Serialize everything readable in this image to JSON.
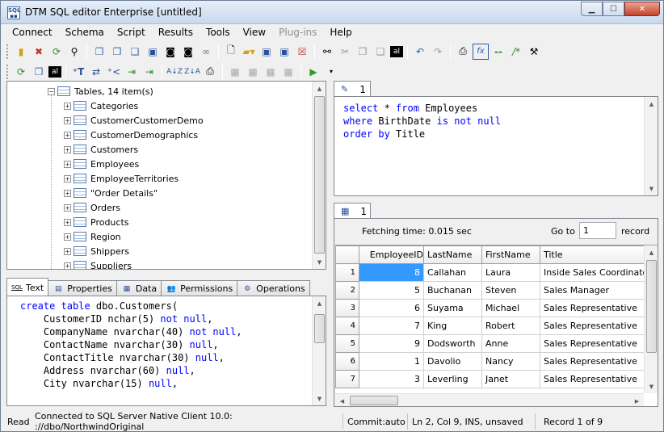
{
  "window": {
    "title": "DTM SQL editor Enterprise [untitled]",
    "controls": {
      "minimize": "minimize",
      "maximize": "maximize",
      "close": "close"
    }
  },
  "menu": {
    "items": [
      {
        "label": "Connect",
        "enabled": true
      },
      {
        "label": "Schema",
        "enabled": true
      },
      {
        "label": "Script",
        "enabled": true
      },
      {
        "label": "Results",
        "enabled": true
      },
      {
        "label": "Tools",
        "enabled": true
      },
      {
        "label": "View",
        "enabled": true
      },
      {
        "label": "Plug-ins",
        "enabled": false
      },
      {
        "label": "Help",
        "enabled": true
      }
    ]
  },
  "toolbar1": {
    "icons": [
      "connect-icon",
      "disconnect-icon",
      "refresh-icon",
      "find-icon",
      "copy-icon",
      "copy-special-icon",
      "paste-icon",
      "save-icon",
      "camera-icon",
      "camera-all-icon",
      "chain-icon",
      "new-file-icon",
      "open-folder-icon",
      "save-file-icon",
      "save-all-icon",
      "close-file-icon",
      "binoculars-icon",
      "cut-icon",
      "copy-text-icon",
      "paste-text-icon",
      "al-icon",
      "undo-icon",
      "redo-icon",
      "print-icon",
      "function-icon",
      "comment-icon",
      "uncomment-icon",
      "settings-icon"
    ]
  },
  "toolbar2": {
    "icons": [
      "refresh-icon",
      "copy-icon",
      "al-icon",
      "insert-text-icon",
      "compare-icon",
      "export-icon",
      "import-icon",
      "sort-az-icon",
      "sort-za-icon",
      "print-icon",
      "table-copy-icon",
      "table-paste-icon",
      "table-add-icon",
      "table-delete-icon",
      "run-icon",
      "run-dropdown-icon"
    ]
  },
  "tree": {
    "root": {
      "label": "Tables, 14 item(s)",
      "expanded": true
    },
    "items": [
      {
        "label": "Categories"
      },
      {
        "label": "CustomerCustomerDemo"
      },
      {
        "label": "CustomerDemographics"
      },
      {
        "label": "Customers"
      },
      {
        "label": "Employees"
      },
      {
        "label": "EmployeeTerritories"
      },
      {
        "label": "\"Order Details\""
      },
      {
        "label": "Orders"
      },
      {
        "label": "Products"
      },
      {
        "label": "Region"
      },
      {
        "label": "Shippers"
      },
      {
        "label": "Suppliers"
      }
    ]
  },
  "object_tabs": [
    {
      "label": "Text",
      "icon": "sql-icon",
      "active": true
    },
    {
      "label": "Properties",
      "icon": "properties-icon",
      "active": false
    },
    {
      "label": "Data",
      "icon": "data-grid-icon",
      "active": false
    },
    {
      "label": "Permissions",
      "icon": "users-icon",
      "active": false
    },
    {
      "label": "Operations",
      "icon": "operations-icon",
      "active": false
    }
  ],
  "ddl": {
    "lines": [
      [
        {
          "t": "create table",
          "k": true
        },
        {
          "t": " dbo.Customers(",
          "k": false
        }
      ],
      [
        {
          "t": "    CustomerID nchar(5) ",
          "k": false
        },
        {
          "t": "not null",
          "k": true
        },
        {
          "t": ",",
          "k": false
        }
      ],
      [
        {
          "t": "    CompanyName nvarchar(40) ",
          "k": false
        },
        {
          "t": "not null",
          "k": true
        },
        {
          "t": ",",
          "k": false
        }
      ],
      [
        {
          "t": "    ContactName nvarchar(30) ",
          "k": false
        },
        {
          "t": "null",
          "k": true
        },
        {
          "t": ",",
          "k": false
        }
      ],
      [
        {
          "t": "    ContactTitle nvarchar(30) ",
          "k": false
        },
        {
          "t": "null",
          "k": true
        },
        {
          "t": ",",
          "k": false
        }
      ],
      [
        {
          "t": "    Address nvarchar(60) ",
          "k": false
        },
        {
          "t": "null",
          "k": true
        },
        {
          "t": ",",
          "k": false
        }
      ],
      [
        {
          "t": "    City nvarchar(15) ",
          "k": false
        },
        {
          "t": "null",
          "k": true
        },
        {
          "t": ",",
          "k": false
        }
      ]
    ]
  },
  "editor": {
    "tab_label": "1",
    "lines": [
      [
        {
          "t": "select",
          "k": true
        },
        {
          "t": " * ",
          "k": false
        },
        {
          "t": "from",
          "k": true
        },
        {
          "t": " Employees",
          "k": false
        }
      ],
      [
        {
          "t": "where",
          "k": true
        },
        {
          "t": " BirthDate ",
          "k": false
        },
        {
          "t": "is not null",
          "k": true
        }
      ],
      [
        {
          "t": "order by",
          "k": true
        },
        {
          "t": " Title",
          "k": false
        }
      ]
    ]
  },
  "results": {
    "tab_label": "1",
    "fetching_time": "Fetching time: 0.015 sec",
    "goto_label": "Go to",
    "goto_value": "1",
    "record_label": "record",
    "columns": [
      "EmployeeID",
      "LastName",
      "FirstName",
      "Title"
    ],
    "rows": [
      {
        "n": "1",
        "EmployeeID": "8",
        "LastName": "Callahan",
        "FirstName": "Laura",
        "Title": "Inside Sales Coordinator"
      },
      {
        "n": "2",
        "EmployeeID": "5",
        "LastName": "Buchanan",
        "FirstName": "Steven",
        "Title": "Sales Manager"
      },
      {
        "n": "3",
        "EmployeeID": "6",
        "LastName": "Suyama",
        "FirstName": "Michael",
        "Title": "Sales Representative"
      },
      {
        "n": "4",
        "EmployeeID": "7",
        "LastName": "King",
        "FirstName": "Robert",
        "Title": "Sales Representative"
      },
      {
        "n": "5",
        "EmployeeID": "9",
        "LastName": "Dodsworth",
        "FirstName": "Anne",
        "Title": "Sales Representative"
      },
      {
        "n": "6",
        "EmployeeID": "1",
        "LastName": "Davolio",
        "FirstName": "Nancy",
        "Title": "Sales Representative"
      },
      {
        "n": "7",
        "EmployeeID": "3",
        "LastName": "Leverling",
        "FirstName": "Janet",
        "Title": "Sales Representative"
      }
    ]
  },
  "status": {
    "mode": "Read",
    "connection": "Connected to SQL Server Native Client 10.0: ://dbo/NorthwindOriginal",
    "commit": "Commit:auto",
    "position": "Ln 2, Col 9, INS, unsaved",
    "record": "Record 1 of 9"
  }
}
